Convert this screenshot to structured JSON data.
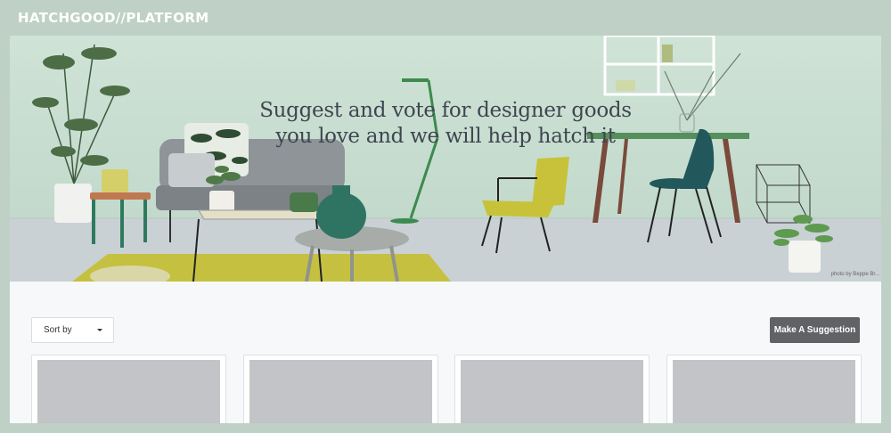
{
  "brand": {
    "name": "HATCHGOOD//PLATFORM"
  },
  "hero": {
    "headline_line1": "Suggest and vote for designer goods",
    "headline_line2": "you love and we will help hatch it",
    "photo_credit": "photo by Beppe Br..."
  },
  "toolbar": {
    "sort_label": "Sort by",
    "suggest_label": "Make A Suggestion"
  },
  "cards": [
    {
      "id": "card-1"
    },
    {
      "id": "card-2"
    },
    {
      "id": "card-3"
    },
    {
      "id": "card-4"
    }
  ],
  "colors": {
    "page_background": "#bfd1c7",
    "content_background": "#f6f8fa",
    "button_background": "#606266",
    "thumbnail_placeholder": "#c2c4c7"
  },
  "icons": {
    "sort_caret": "caret-down-icon"
  }
}
